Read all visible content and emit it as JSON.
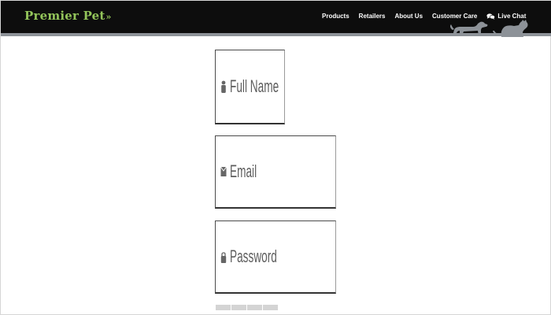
{
  "brand": {
    "name": "Premier Pet",
    "mark": "»",
    "color": "#93c45a"
  },
  "nav": {
    "items": [
      {
        "label": "Products"
      },
      {
        "label": "Retailers"
      },
      {
        "label": "About Us"
      },
      {
        "label": "Customer Care"
      }
    ],
    "chat": {
      "label": "Live Chat",
      "icon": "chat-bubbles-icon"
    }
  },
  "header": {
    "background": "#0d0d0d",
    "strip_color": "#8d9298",
    "decoration": "dog-and-cat-silhouette"
  },
  "form": {
    "full_name": {
      "placeholder": "Full Name",
      "icon": "user-icon",
      "value": ""
    },
    "email": {
      "placeholder": "Email",
      "icon": "envelope-icon",
      "value": ""
    },
    "password": {
      "placeholder": "Password",
      "icon": "lock-icon",
      "value": ""
    }
  },
  "progress": {
    "segments": 4
  }
}
